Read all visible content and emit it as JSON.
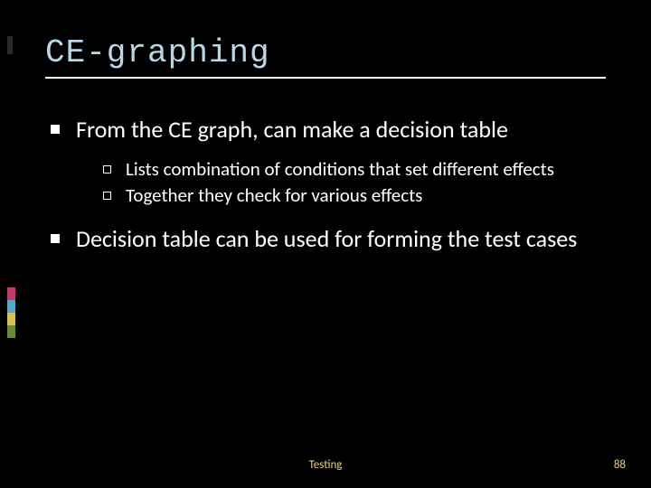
{
  "title": "CE-graphing",
  "bullets": [
    {
      "level": 1,
      "text": "From the CE graph, can make a decision table"
    },
    {
      "level": 2,
      "text": "Lists combination of conditions that set different effects"
    },
    {
      "level": 2,
      "text": "Together they check for various effects"
    },
    {
      "level": 1,
      "text": "Decision table can be used for forming the test cases"
    }
  ],
  "footer": {
    "label": "Testing",
    "page": "88"
  },
  "accents": {
    "top": [
      {
        "color": "#2a2a2a",
        "h": 20
      }
    ],
    "bottom": [
      {
        "color": "#c43a6a",
        "h": 14
      },
      {
        "color": "#5aa8c8",
        "h": 14
      },
      {
        "color": "#d8c058",
        "h": 14
      },
      {
        "color": "#6a8a3a",
        "h": 14
      }
    ]
  }
}
